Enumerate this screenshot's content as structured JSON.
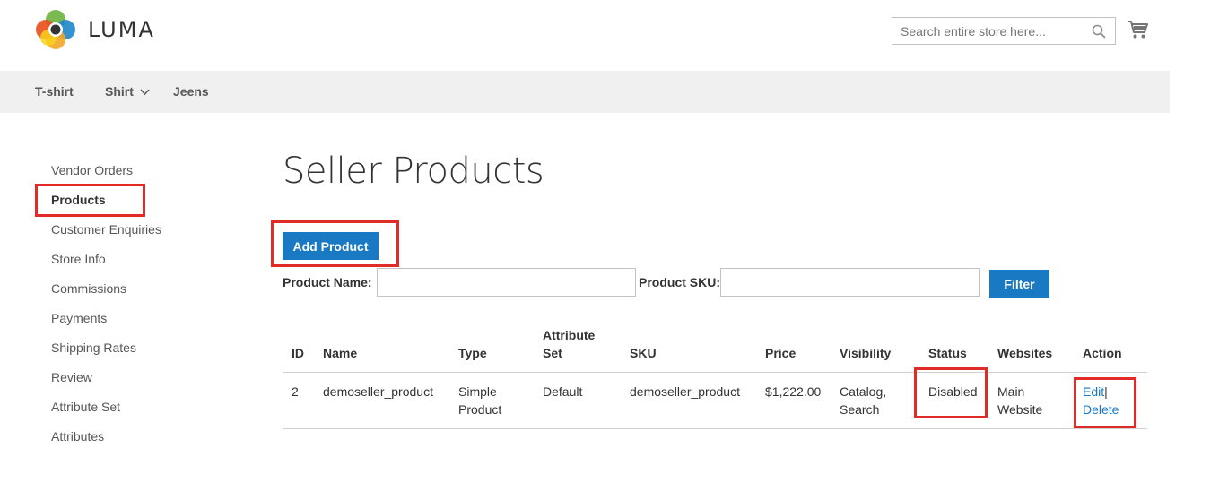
{
  "brand": {
    "name": "LUMA"
  },
  "search": {
    "placeholder": "Search entire store here..."
  },
  "nav": {
    "items": [
      {
        "label": "T-shirt"
      },
      {
        "label": "Shirt"
      },
      {
        "label": "Jeens"
      }
    ]
  },
  "sidebar": {
    "items": [
      {
        "label": "Vendor Orders"
      },
      {
        "label": "Products"
      },
      {
        "label": "Customer Enquiries"
      },
      {
        "label": "Store Info"
      },
      {
        "label": "Commissions"
      },
      {
        "label": "Payments"
      },
      {
        "label": "Shipping Rates"
      },
      {
        "label": "Review"
      },
      {
        "label": "Attribute Set"
      },
      {
        "label": "Attributes"
      }
    ]
  },
  "main": {
    "title": "Seller Products",
    "add_product_label": "Add Product",
    "filter": {
      "name_label": "Product Name:",
      "name_value": "",
      "sku_label": "Product SKU:",
      "sku_value": "",
      "button_label": "Filter"
    }
  },
  "table": {
    "headers": {
      "id": "ID",
      "name": "Name",
      "type": "Type",
      "attribute_set_1": "Attribute",
      "attribute_set_2": "Set",
      "sku": "SKU",
      "price": "Price",
      "visibility": "Visibility",
      "status": "Status",
      "websites": "Websites",
      "action": "Action"
    },
    "rows": [
      {
        "id": "2",
        "name": "demoseller_product",
        "type_1": "Simple",
        "type_2": "Product",
        "attribute_set": "Default",
        "sku": "demoseller_product",
        "price": "$1,222.00",
        "visibility_1": "Catalog,",
        "visibility_2": "Search",
        "status": "Disabled",
        "websites_1": "Main",
        "websites_2": "Website",
        "edit_label": "Edit",
        "separator": "|",
        "delete_label": "Delete"
      }
    ]
  },
  "colors": {
    "primary": "#1979c3",
    "highlight": "#e02b27",
    "nav_bg": "#f0f0f0"
  }
}
